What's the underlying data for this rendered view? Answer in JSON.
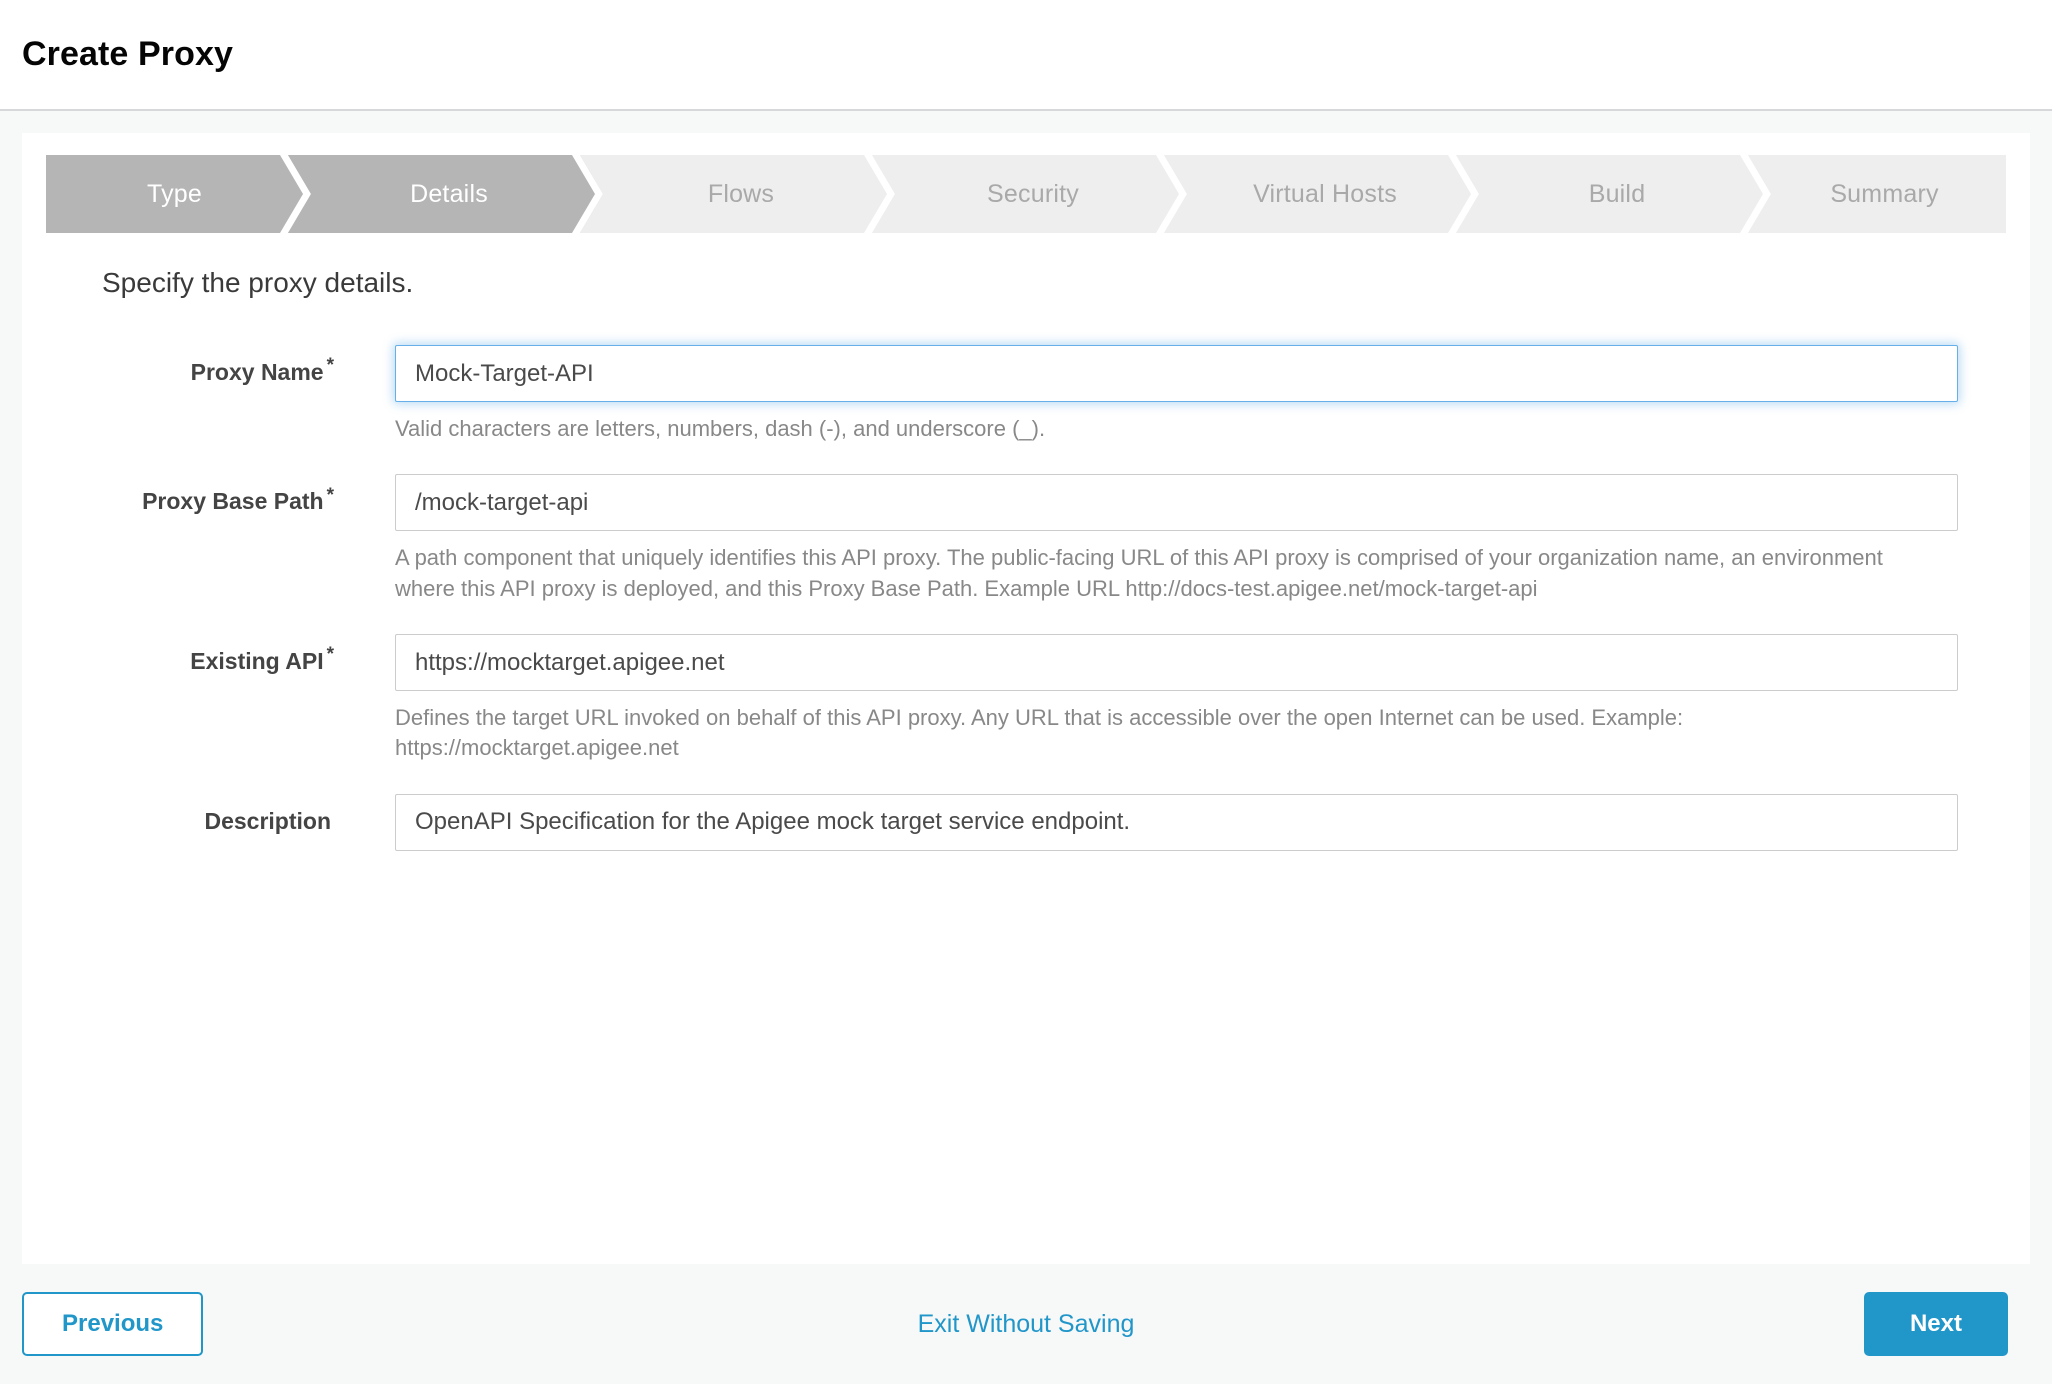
{
  "header": {
    "title": "Create Proxy"
  },
  "wizard": {
    "steps": [
      {
        "label": "Type",
        "state": "active"
      },
      {
        "label": "Details",
        "state": "active"
      },
      {
        "label": "Flows",
        "state": "inactive"
      },
      {
        "label": "Security",
        "state": "inactive"
      },
      {
        "label": "Virtual Hosts",
        "state": "inactive"
      },
      {
        "label": "Build",
        "state": "inactive"
      },
      {
        "label": "Summary",
        "state": "inactive"
      }
    ]
  },
  "main": {
    "section_title": "Specify the proxy details.",
    "fields": {
      "proxy_name": {
        "label": "Proxy Name",
        "required_marker": "*",
        "value": "Mock-Target-API",
        "helper": "Valid characters are letters, numbers, dash (-), and underscore (_)."
      },
      "proxy_base_path": {
        "label": "Proxy Base Path",
        "required_marker": "*",
        "value": "/mock-target-api",
        "helper": "A path component that uniquely identifies this API proxy. The public-facing URL of this API proxy is comprised of your organization name, an environment where this API proxy is deployed, and this Proxy Base Path. Example URL http://docs-test.apigee.net/mock-target-api"
      },
      "existing_api": {
        "label": "Existing API",
        "required_marker": "*",
        "value": "https://mocktarget.apigee.net",
        "helper": "Defines the target URL invoked on behalf of this API proxy. Any URL that is accessible over the open Internet can be used. Example: https://mocktarget.apigee.net"
      },
      "description": {
        "label": "Description",
        "required_marker": "",
        "value": "OpenAPI Specification for the Apigee mock target service endpoint.",
        "helper": ""
      }
    }
  },
  "footer": {
    "previous_label": "Previous",
    "exit_label": "Exit Without Saving",
    "next_label": "Next"
  },
  "colors": {
    "accent": "#2196c9",
    "step_active_bg": "#b5b5b5",
    "step_inactive_bg": "#eeeeee",
    "focus_border": "#66afe9"
  }
}
